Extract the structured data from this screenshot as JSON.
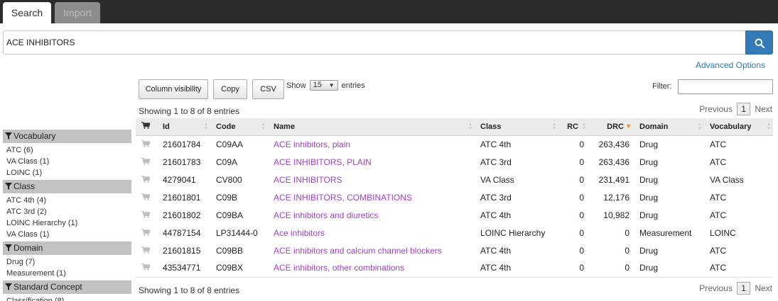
{
  "tabs": [
    {
      "label": "Search"
    },
    {
      "label": "Import"
    }
  ],
  "search": {
    "value": "ACE INHIBITORS"
  },
  "advanced_options_label": "Advanced Options",
  "toolbar": {
    "column_visibility_label": "Column visibility",
    "copy_label": "Copy",
    "csv_label": "CSV",
    "show_label": "Show",
    "page_length": "15",
    "entries_label": "entries",
    "filter_label": "Filter:"
  },
  "info_text": "Showing 1 to 8 of 8 entries",
  "pager": {
    "previous": "Previous",
    "current": "1",
    "next": "Next"
  },
  "facets": [
    {
      "title": "Vocabulary",
      "items": [
        "ATC (6)",
        "VA Class (1)",
        "LOINC (1)"
      ]
    },
    {
      "title": "Class",
      "items": [
        "ATC 4th (4)",
        "ATC 3rd (2)",
        "LOINC Hierarchy (1)",
        "VA Class (1)"
      ]
    },
    {
      "title": "Domain",
      "items": [
        "Drug (7)",
        "Measurement (1)"
      ]
    },
    {
      "title": "Standard Concept",
      "items": [
        "Classification (8)"
      ]
    }
  ],
  "columns": [
    "Id",
    "Code",
    "Name",
    "Class",
    "RC",
    "DRC",
    "Domain",
    "Vocabulary"
  ],
  "rows": [
    {
      "id": "21601784",
      "code": "C09AA",
      "name": "ACE inhibitors, plain",
      "class": "ATC 4th",
      "rc": "0",
      "drc": "263,436",
      "domain": "Drug",
      "vocabulary": "ATC"
    },
    {
      "id": "21601783",
      "code": "C09A",
      "name": "ACE INHIBITORS, PLAIN",
      "class": "ATC 3rd",
      "rc": "0",
      "drc": "263,436",
      "domain": "Drug",
      "vocabulary": "ATC"
    },
    {
      "id": "4279041",
      "code": "CV800",
      "name": "ACE INHIBITORS",
      "class": "VA Class",
      "rc": "0",
      "drc": "231,491",
      "domain": "Drug",
      "vocabulary": "VA Class"
    },
    {
      "id": "21601801",
      "code": "C09B",
      "name": "ACE INHIBITORS, COMBINATIONS",
      "class": "ATC 3rd",
      "rc": "0",
      "drc": "12,176",
      "domain": "Drug",
      "vocabulary": "ATC"
    },
    {
      "id": "21601802",
      "code": "C09BA",
      "name": "ACE inhibitors and diuretics",
      "class": "ATC 4th",
      "rc": "0",
      "drc": "10,982",
      "domain": "Drug",
      "vocabulary": "ATC"
    },
    {
      "id": "44787154",
      "code": "LP31444-0",
      "name": "Ace inhibitors",
      "class": "LOINC Hierarchy",
      "rc": "0",
      "drc": "0",
      "domain": "Measurement",
      "vocabulary": "LOINC"
    },
    {
      "id": "21601815",
      "code": "C09BB",
      "name": "ACE inhibitors and calcium channel blockers",
      "class": "ATC 4th",
      "rc": "0",
      "drc": "0",
      "domain": "Drug",
      "vocabulary": "ATC"
    },
    {
      "id": "43534771",
      "code": "C09BX",
      "name": "ACE inhibitors, other combinations",
      "class": "ATC 4th",
      "rc": "0",
      "drc": "0",
      "domain": "Drug",
      "vocabulary": "ATC"
    }
  ],
  "colors": {
    "accent": "#337ab7",
    "link": "#a040c8",
    "sort_active": "#f08a24"
  }
}
